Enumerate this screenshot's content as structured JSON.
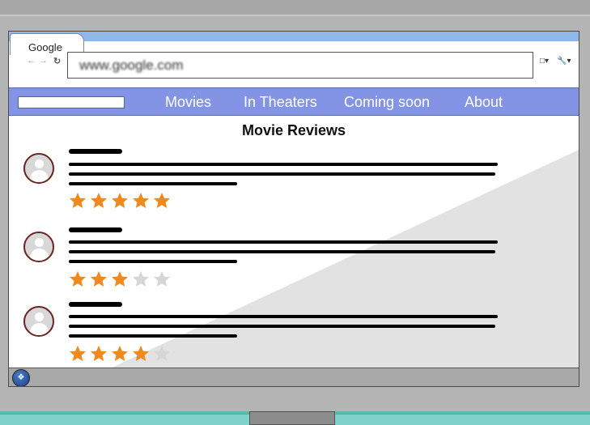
{
  "browser": {
    "tab_title": "Google",
    "address": "www.google.com",
    "back_icon": "arrow-left-icon",
    "forward_icon": "arrow-right-icon",
    "reload_icon": "reload-icon",
    "page_icon": "page-menu-icon",
    "wrench_icon": "wrench-icon"
  },
  "navbar": {
    "links": [
      "Movies",
      "In Theaters",
      "Coming soon",
      "About"
    ]
  },
  "page": {
    "title": "Movie Reviews"
  },
  "reviews": [
    {
      "rating": 5,
      "max": 5
    },
    {
      "rating": 3,
      "max": 5
    },
    {
      "rating": 4,
      "max": 5
    }
  ],
  "colors": {
    "star_filled": "#ee8a1e",
    "star_empty": "#d6d6d6",
    "navbar": "#8294e3",
    "tab_bar": "#8fb8e9"
  }
}
